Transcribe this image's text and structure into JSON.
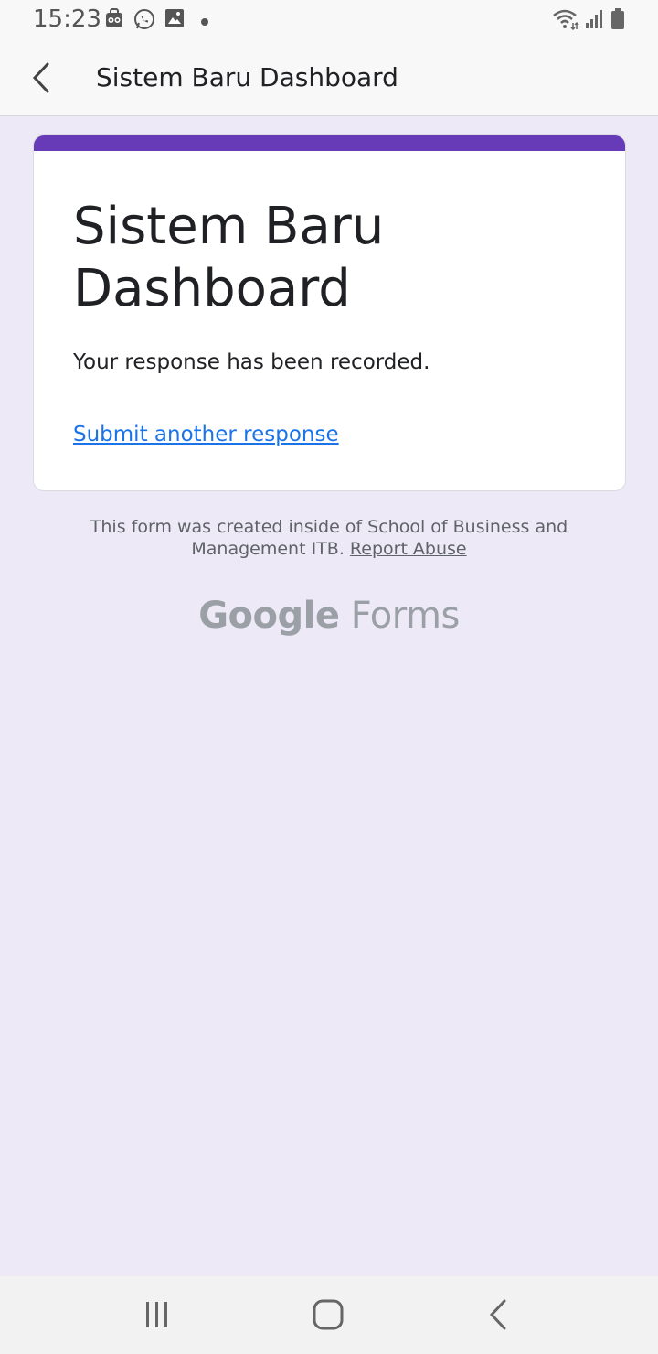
{
  "status_bar": {
    "time": "15:23",
    "icons_left": [
      "app-notification-icon",
      "whatsapp-icon",
      "gallery-icon",
      "dot-icon"
    ],
    "icons_right": [
      "wifi-icon",
      "signal-icon",
      "battery-icon"
    ]
  },
  "app_bar": {
    "title": "Sistem Baru Dashboard",
    "back_icon": "chevron-left-icon"
  },
  "card": {
    "accent_color": "#673ab7",
    "title": "Sistem Baru Dashboard",
    "message": "Your response has been recorded.",
    "link": "Submit another response"
  },
  "footer": {
    "text": "This form was created inside of School of Business and Management ITB.",
    "report_link": "Report Abuse",
    "logo_google": "Google",
    "logo_forms": "Forms"
  },
  "nav_bar": {
    "recent_icon": "recent-apps-icon",
    "home_icon": "home-icon",
    "back_icon": "back-icon"
  }
}
